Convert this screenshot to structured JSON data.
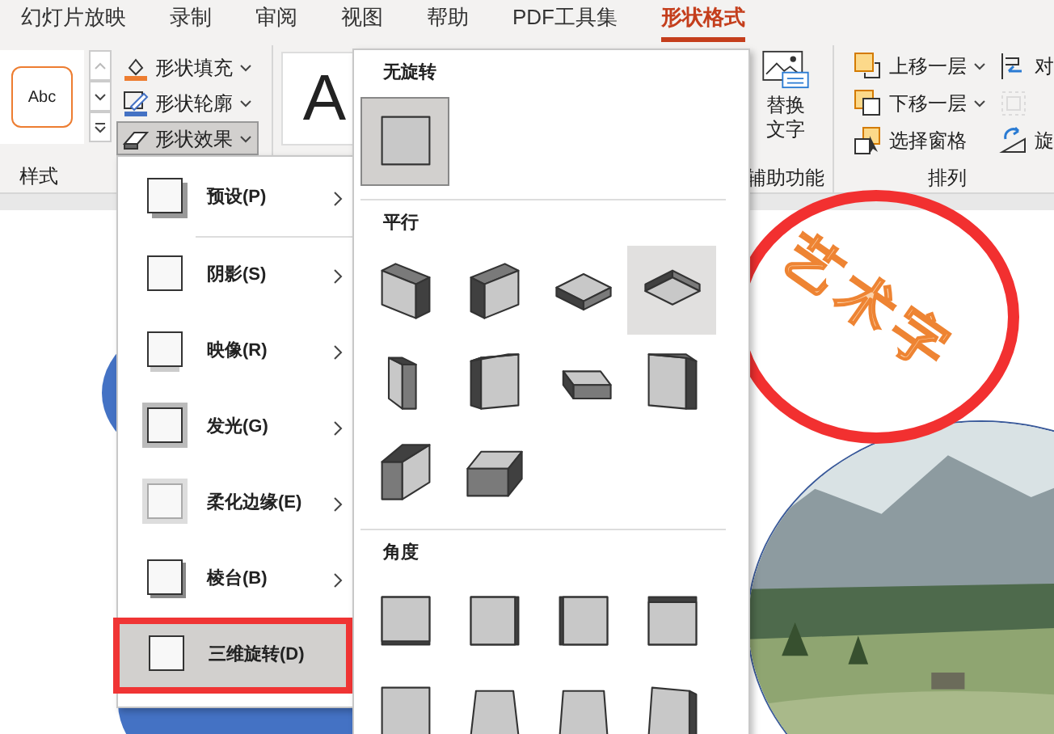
{
  "tabs": [
    {
      "label": "幻灯片放映",
      "selected": false
    },
    {
      "label": "录制",
      "selected": false
    },
    {
      "label": "审阅",
      "selected": false
    },
    {
      "label": "视图",
      "selected": false
    },
    {
      "label": "帮助",
      "selected": false
    },
    {
      "label": "PDF工具集",
      "selected": false
    },
    {
      "label": "形状格式",
      "selected": true
    }
  ],
  "ribbon": {
    "style_group": {
      "label": "样式",
      "preview": "Abc",
      "commands": [
        {
          "kind": "fill",
          "label": "形状填充",
          "pressed": false
        },
        {
          "kind": "outline",
          "label": "形状轮廓",
          "pressed": false
        },
        {
          "kind": "effects",
          "label": "形状效果",
          "pressed": true
        }
      ]
    },
    "wordart_preview": "A",
    "accessibility_group": {
      "label": "辅助功能",
      "button": "替换文字"
    },
    "arrange_group": {
      "label": "排列",
      "commands": [
        {
          "kind": "forward",
          "label": "上移一层",
          "dropdown": true
        },
        {
          "kind": "backward",
          "label": "下移一层",
          "dropdown": true
        },
        {
          "kind": "pane",
          "label": "选择窗格",
          "dropdown": false
        }
      ],
      "side_commands": [
        {
          "kind": "align",
          "label": "对",
          "disabled": false
        },
        {
          "kind": "group",
          "disabled": true
        },
        {
          "kind": "rotate",
          "label": "旋",
          "disabled": false
        }
      ]
    }
  },
  "effects_menu": {
    "items": [
      {
        "label": "预设(P)",
        "has_submenu": true,
        "selected": false
      },
      {
        "label": "阴影(S)",
        "has_submenu": true,
        "selected": false
      },
      {
        "label": "映像(R)",
        "has_submenu": true,
        "selected": false
      },
      {
        "label": "发光(G)",
        "has_submenu": true,
        "selected": false
      },
      {
        "label": "柔化边缘(E)",
        "has_submenu": true,
        "selected": false
      },
      {
        "label": "棱台(B)",
        "has_submenu": true,
        "selected": false
      },
      {
        "label": "三维旋转(D)",
        "has_submenu": false,
        "selected": true
      }
    ]
  },
  "rotation_gallery": {
    "sections": [
      {
        "title": "无旋转",
        "items": [
          {
            "selected": true,
            "hovered": false
          }
        ]
      },
      {
        "title": "平行",
        "items": [
          {
            "selected": false,
            "hovered": false
          },
          {
            "selected": false,
            "hovered": false
          },
          {
            "selected": false,
            "hovered": false
          },
          {
            "selected": false,
            "hovered": true
          },
          {
            "selected": false,
            "hovered": false
          },
          {
            "selected": false,
            "hovered": false
          },
          {
            "selected": false,
            "hovered": false
          },
          {
            "selected": false,
            "hovered": false
          },
          {
            "selected": false,
            "hovered": false
          },
          {
            "selected": false,
            "hovered": false
          }
        ]
      },
      {
        "title": "角度",
        "items": [
          {
            "selected": false,
            "hovered": false
          },
          {
            "selected": false,
            "hovered": false
          },
          {
            "selected": false,
            "hovered": false
          },
          {
            "selected": false,
            "hovered": false
          },
          {
            "selected": false,
            "hovered": false
          },
          {
            "selected": false,
            "hovered": false
          },
          {
            "selected": false,
            "hovered": false
          },
          {
            "selected": false,
            "hovered": false
          }
        ]
      }
    ]
  },
  "slide": {
    "wordart": "艺术字"
  }
}
